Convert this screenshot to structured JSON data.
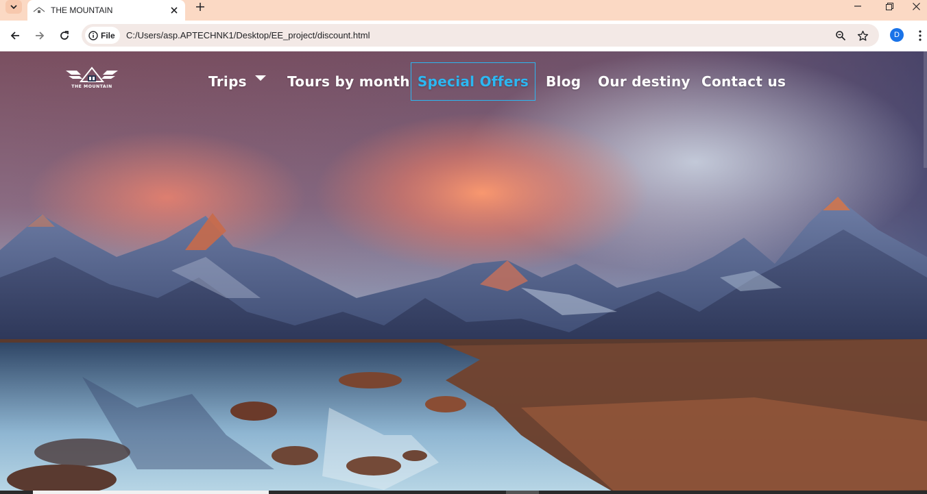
{
  "browser": {
    "tab_title": "THE MOUNTAIN",
    "chip_label": "File",
    "url": "C:/Users/asp.APTECHNK1/Desktop/EE_project/discount.html",
    "profile_initial": "D"
  },
  "site": {
    "logo_text": "THE MOUNTAIN",
    "nav": [
      {
        "label": "Trips",
        "has_dropdown": true
      },
      {
        "label": "Tours by month"
      },
      {
        "label": "Special Offers",
        "active": true
      },
      {
        "label": "Blog"
      },
      {
        "label": "Our destiny"
      },
      {
        "label": "Contact us"
      }
    ]
  },
  "colors": {
    "tabstrip": "#fbd9c4",
    "active_nav": "#2cb7f2",
    "nav_text": "#ffffff"
  },
  "icons": {
    "tab_search": "chevron-down-icon",
    "tab_close": "close-icon",
    "new_tab": "plus-icon",
    "back": "arrow-left-icon",
    "forward": "arrow-right-icon",
    "reload": "reload-icon",
    "site_info": "info-icon",
    "zoom": "zoom-icon",
    "bookmark": "star-icon",
    "menu": "more-vert-icon"
  }
}
